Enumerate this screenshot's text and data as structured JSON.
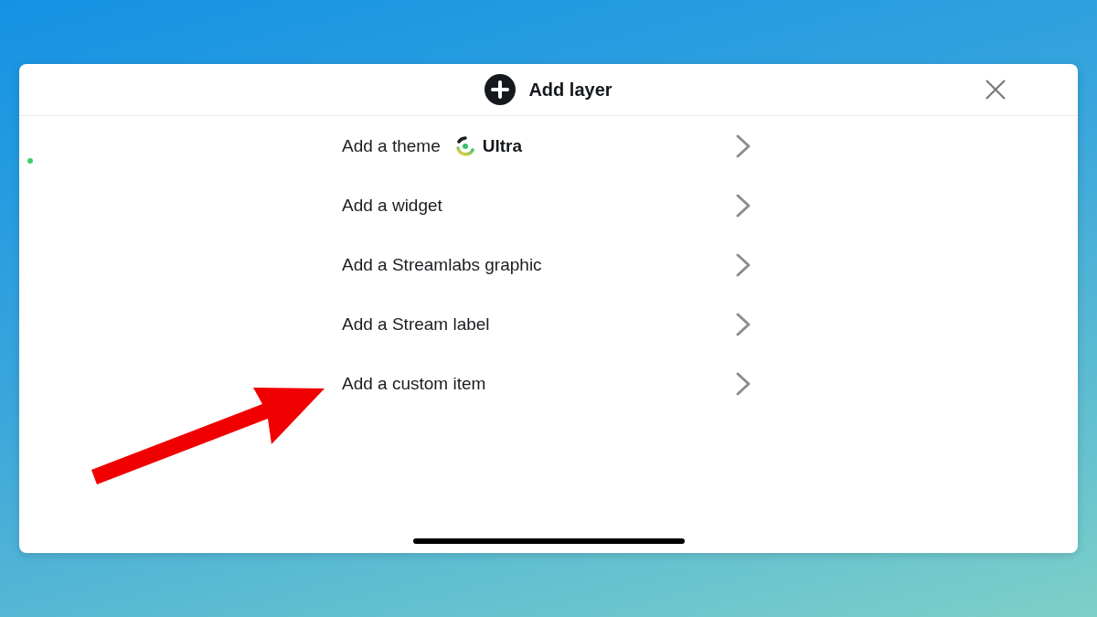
{
  "dialog": {
    "title": "Add layer"
  },
  "items": [
    {
      "label": "Add a theme",
      "badge": "Ultra"
    },
    {
      "label": "Add a widget"
    },
    {
      "label": "Add a Streamlabs graphic"
    },
    {
      "label": "Add a Stream label"
    },
    {
      "label": "Add a custom item"
    }
  ]
}
